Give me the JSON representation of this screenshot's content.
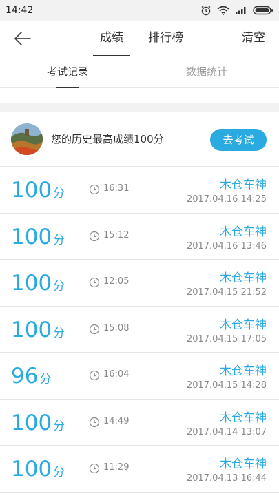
{
  "status": {
    "time": "14:42"
  },
  "nav": {
    "tabs": [
      {
        "label": "成绩",
        "active": true
      },
      {
        "label": "排行榜",
        "active": false
      }
    ],
    "clear_label": "清空"
  },
  "subtabs": [
    {
      "label": "考试记录",
      "active": true
    },
    {
      "label": "数据统计",
      "active": false
    }
  ],
  "best": {
    "text": "您的历史最高成绩100分",
    "button_label": "去考试"
  },
  "records": [
    {
      "score": "100",
      "unit": "分",
      "duration": "16:31",
      "name": "木仓车神",
      "date": "2017.04.16  14:25"
    },
    {
      "score": "100",
      "unit": "分",
      "duration": "15:12",
      "name": "木仓车神",
      "date": "2017.04.16  13:46"
    },
    {
      "score": "100",
      "unit": "分",
      "duration": "12:05",
      "name": "木仓车神",
      "date": "2017.04.15  21:52"
    },
    {
      "score": "100",
      "unit": "分",
      "duration": "15:08",
      "name": "木仓车神",
      "date": "2017.04.15  17:05"
    },
    {
      "score": "96",
      "unit": "分",
      "duration": "16:04",
      "name": "木仓车神",
      "date": "2017.04.15  14:28"
    },
    {
      "score": "100",
      "unit": "分",
      "duration": "14:49",
      "name": "木仓车神",
      "date": "2017.04.14  13:07"
    },
    {
      "score": "100",
      "unit": "分",
      "duration": "11:29",
      "name": "木仓车神",
      "date": "2017.04.13  16:44"
    }
  ],
  "colors": {
    "accent": "#29aae1",
    "text": "#333333",
    "muted": "#8a8a8a",
    "divider": "#e5e5e5"
  }
}
